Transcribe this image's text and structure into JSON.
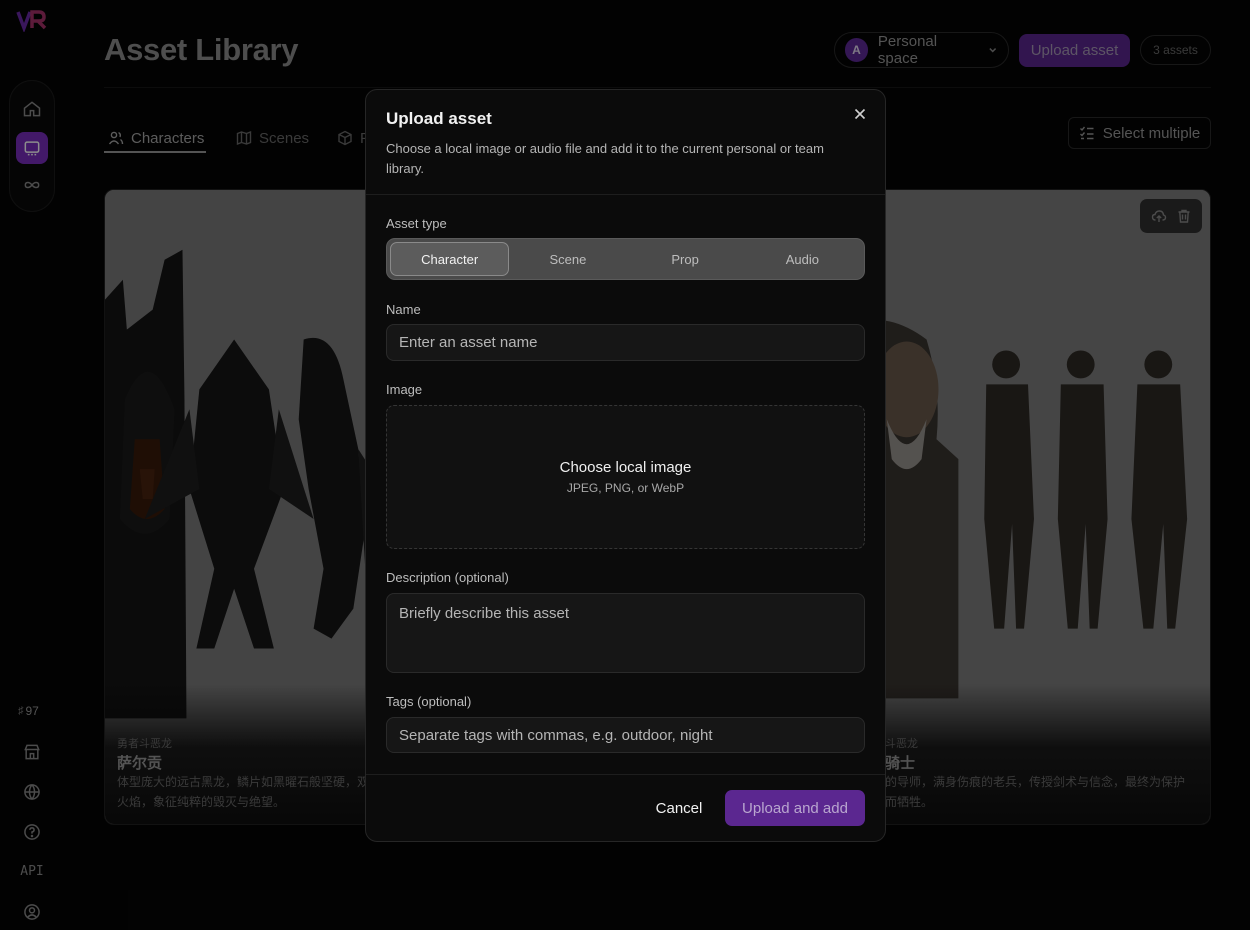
{
  "header": {
    "title": "Asset Library",
    "space_initial": "A",
    "space_label": "Personal space",
    "upload_label": "Upload asset",
    "count_label": "3 assets"
  },
  "sidebar": {
    "credits": "97",
    "api_label": "API",
    "icons": [
      "home-icon",
      "library-icon",
      "infinity-icon",
      "store-icon",
      "globe-icon",
      "help-icon",
      "user-icon"
    ]
  },
  "tabs": [
    {
      "label": "Characters",
      "icon": "users-icon",
      "active": true
    },
    {
      "label": "Scenes",
      "icon": "map-icon",
      "active": false
    },
    {
      "label": "P",
      "icon": "box-icon",
      "active": false
    }
  ],
  "toolbar": {
    "select_multiple": "Select multiple"
  },
  "cards": [
    {
      "tag": "勇者斗恶龙",
      "name": "萨尔贡",
      "desc_line1": "体型庞大的远古黑龙，鳞片如黑曜石般坚硬，双",
      "desc_line2": "火焰，象征纯粹的毁灭与绝望。"
    },
    {
      "tag": "斗恶龙",
      "name": "骑士",
      "desc_line1": "的导师，满身伤痕的老兵，传授剑术与信念，最终为保护",
      "desc_line2": "而牺牲。"
    }
  ],
  "modal": {
    "title": "Upload asset",
    "subtitle": "Choose a local image or audio file and add it to the current personal or team library.",
    "asset_type_label": "Asset type",
    "asset_types": [
      "Character",
      "Scene",
      "Prop",
      "Audio"
    ],
    "selected_type": "Character",
    "name_label": "Name",
    "name_placeholder": "Enter an asset name",
    "image_label": "Image",
    "dropzone_title": "Choose local image",
    "dropzone_sub": "JPEG, PNG, or WebP",
    "description_label": "Description (optional)",
    "description_placeholder": "Briefly describe this asset",
    "tags_label": "Tags (optional)",
    "tags_placeholder": "Separate tags with commas, e.g. outdoor, night",
    "cancel_label": "Cancel",
    "submit_label": "Upload and add"
  },
  "colors": {
    "accent": "#7a2fc0",
    "background": "#050505",
    "modal_bg": "#0b0b0b"
  }
}
